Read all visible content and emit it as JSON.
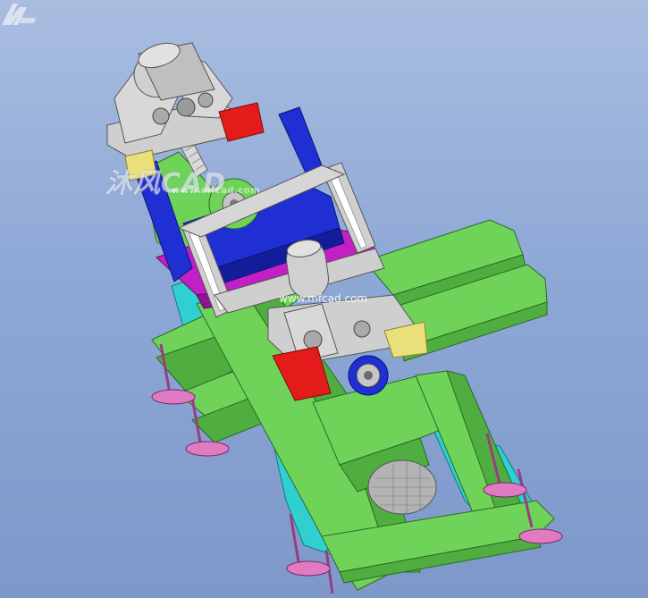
{
  "viewport": {
    "background_top": "#a9bde0",
    "background_bottom": "#7d98c9"
  },
  "model_colors": {
    "frame": "#6fd35a",
    "frame_dark": "#4fae3f",
    "base": "#2fd0cf",
    "clamp": "#1f2fd4",
    "slide": "#c21fc6",
    "bracket": "#cfcfcf",
    "block_red": "#e41b1b",
    "block_yellow": "#e9e07a",
    "foot": "#e07ac3",
    "roller": "#b3b3b3"
  },
  "watermark": {
    "brand": "沐风CAD",
    "site_top": "www.mfcad.com",
    "site_mid": "www.mfcad.com",
    "logo_icon": "mf-logo-icon"
  }
}
